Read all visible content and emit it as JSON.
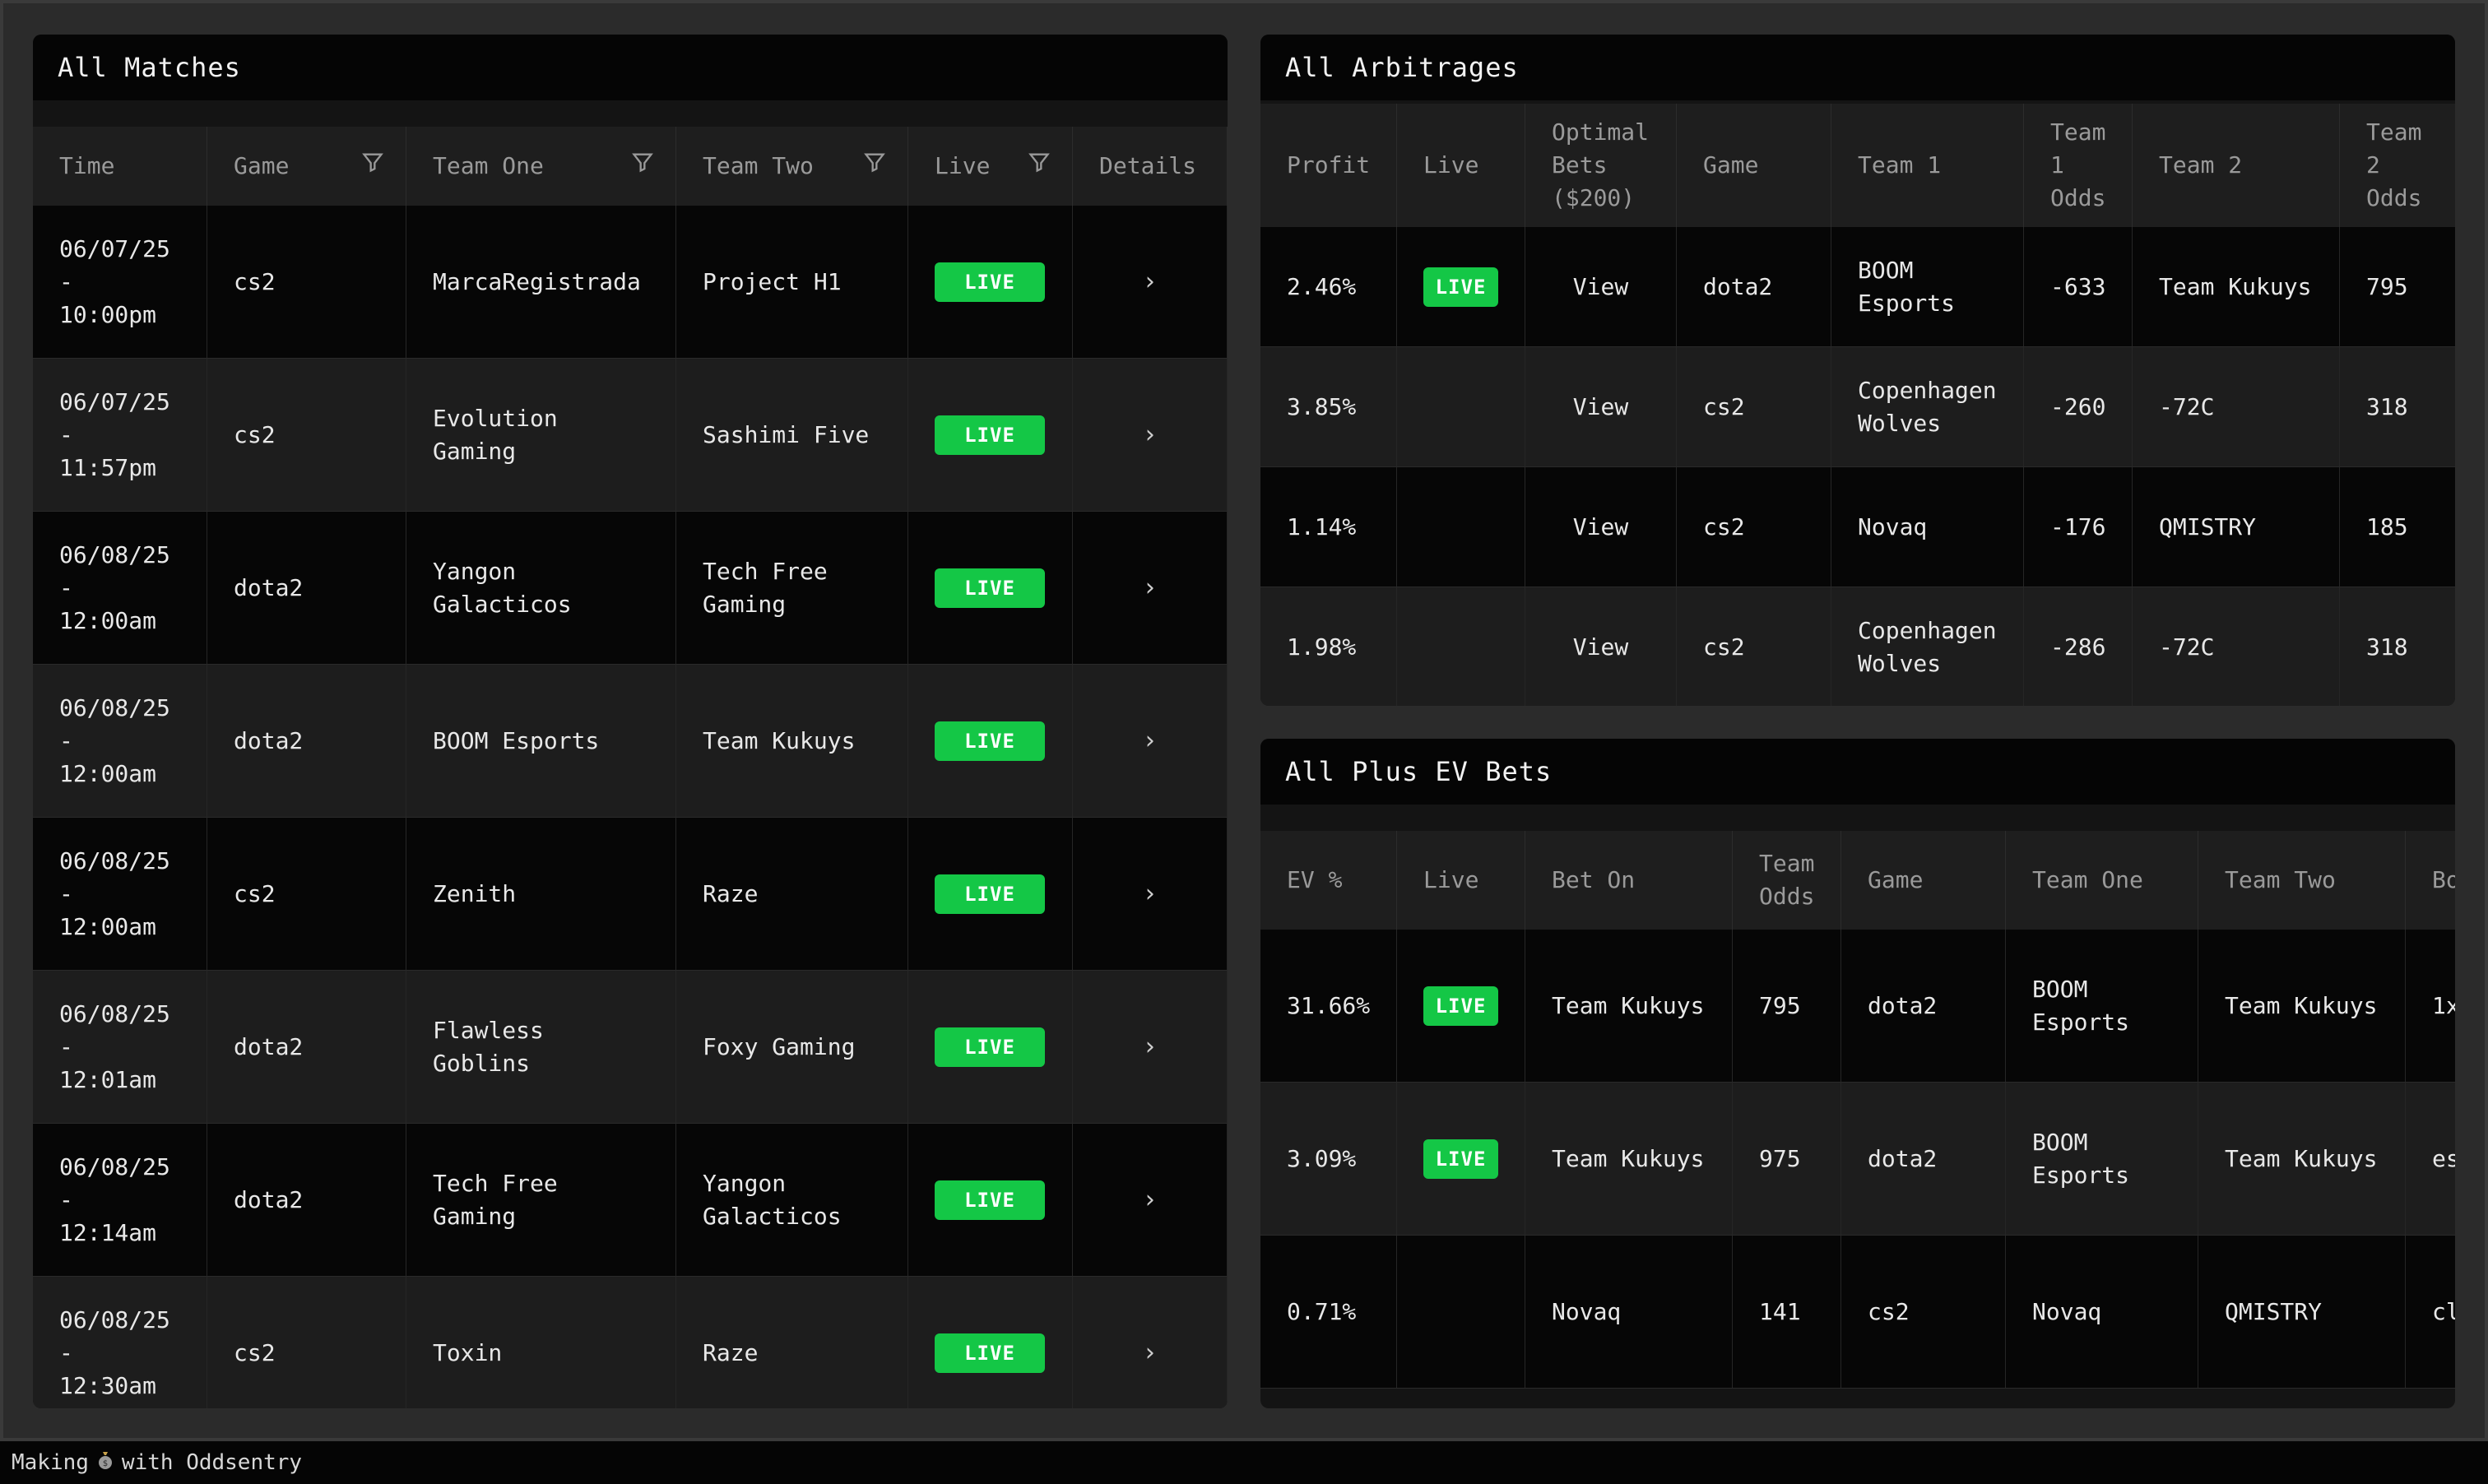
{
  "matches": {
    "title": "All Matches",
    "headers": [
      "Time",
      "Game",
      "Team One",
      "Team Two",
      "Live",
      "Details"
    ],
    "rows": [
      {
        "time_date": "06/07/25",
        "time_sep": "-",
        "time_clock": "10:00pm",
        "game": "cs2",
        "team_one": "MarcaRegistrada",
        "team_two": "Project H1",
        "live": "LIVE",
        "details": "›"
      },
      {
        "time_date": "06/07/25",
        "time_sep": "-",
        "time_clock": "11:57pm",
        "game": "cs2",
        "team_one": "Evolution Gaming",
        "team_two": "Sashimi Five",
        "live": "LIVE",
        "details": "›"
      },
      {
        "time_date": "06/08/25",
        "time_sep": "-",
        "time_clock": "12:00am",
        "game": "dota2",
        "team_one": "Yangon Galacticos",
        "team_two": "Tech Free Gaming",
        "live": "LIVE",
        "details": "›"
      },
      {
        "time_date": "06/08/25",
        "time_sep": "-",
        "time_clock": "12:00am",
        "game": "dota2",
        "team_one": "BOOM Esports",
        "team_two": "Team Kukuys",
        "live": "LIVE",
        "details": "›"
      },
      {
        "time_date": "06/08/25",
        "time_sep": "-",
        "time_clock": "12:00am",
        "game": "cs2",
        "team_one": "Zenith",
        "team_two": "Raze",
        "live": "LIVE",
        "details": "›"
      },
      {
        "time_date": "06/08/25",
        "time_sep": "-",
        "time_clock": "12:01am",
        "game": "dota2",
        "team_one": "Flawless Goblins",
        "team_two": "Foxy Gaming",
        "live": "LIVE",
        "details": "›"
      },
      {
        "time_date": "06/08/25",
        "time_sep": "-",
        "time_clock": "12:14am",
        "game": "dota2",
        "team_one": "Tech Free Gaming",
        "team_two": "Yangon Galacticos",
        "live": "LIVE",
        "details": "›"
      },
      {
        "time_date": "06/08/25",
        "time_sep": "-",
        "time_clock": "12:30am",
        "game": "cs2",
        "team_one": "Toxin",
        "team_two": "Raze",
        "live": "LIVE",
        "details": "›"
      }
    ]
  },
  "arbitrages": {
    "title": "All Arbitrages",
    "headers": [
      "Profit",
      "Live",
      "Optimal Bets ($200)",
      "Game",
      "Team 1",
      "Team 1 Odds",
      "Team 2",
      "Team 2 Odds"
    ],
    "rows": [
      {
        "profit": "2.46%",
        "live": "LIVE",
        "bets": "View",
        "game": "dota2",
        "team1": "BOOM Esports",
        "team1_odds": "-633",
        "team2": "Team Kukuys",
        "team2_odds": "795"
      },
      {
        "profit": "3.85%",
        "live": "",
        "bets": "View",
        "game": "cs2",
        "team1": "Copenhagen Wolves",
        "team1_odds": "-260",
        "team2": "-72C",
        "team2_odds": "318"
      },
      {
        "profit": "1.14%",
        "live": "",
        "bets": "View",
        "game": "cs2",
        "team1": "Novaq",
        "team1_odds": "-176",
        "team2": "QMISTRY",
        "team2_odds": "185"
      },
      {
        "profit": "1.98%",
        "live": "",
        "bets": "View",
        "game": "cs2",
        "team1": "Copenhagen Wolves",
        "team1_odds": "-286",
        "team2": "-72C",
        "team2_odds": "318"
      }
    ]
  },
  "ev": {
    "title": "All Plus EV Bets",
    "headers": [
      "EV %",
      "Live",
      "Bet On",
      "Team Odds",
      "Game",
      "Team One",
      "Team Two",
      "Bo"
    ],
    "rows": [
      {
        "ev": "31.66%",
        "live": "LIVE",
        "bet_on": "Team Kukuys",
        "odds": "795",
        "game": "dota2",
        "team_one": "BOOM Esports",
        "team_two": "Team Kukuys",
        "book": "1x"
      },
      {
        "ev": "3.09%",
        "live": "LIVE",
        "bet_on": "Team Kukuys",
        "odds": "975",
        "game": "dota2",
        "team_one": "BOOM Esports",
        "team_two": "Team Kukuys",
        "book": "es"
      },
      {
        "ev": "0.71%",
        "live": "",
        "bet_on": "Novaq",
        "odds": "141",
        "game": "cs2",
        "team_one": "Novaq",
        "team_two": "QMISTRY",
        "book": "cl"
      }
    ]
  },
  "footer": {
    "left": "Making",
    "icon": "money-bag-icon",
    "right": "with Oddsentry"
  },
  "colors": {
    "live_badge": "#14c746",
    "background": "#2b2b2b",
    "card_header": "#050505"
  }
}
